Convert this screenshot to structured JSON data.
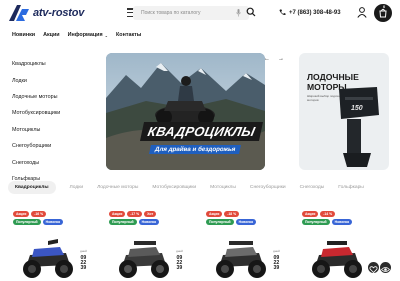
{
  "header": {
    "logo_text": "atv-rostov",
    "search_placeholder": "Поиск товара по каталогу",
    "phone": "+7 (863) 308-48-93",
    "cart_count": "0"
  },
  "nav": {
    "items": [
      "Новинки",
      "Акции",
      "Информация",
      "Контакты"
    ]
  },
  "sidebar": {
    "items": [
      "Квадроциклы",
      "Лодки",
      "Лодочные моторы",
      "Мотобуксировщики",
      "Мотоциклы",
      "Снегоуборщики",
      "Снегоходы",
      "Гольфкары"
    ]
  },
  "banner": {
    "title": "КВАДРОЦИКЛЫ",
    "subtitle": "Для драйва и бездорожья",
    "prev": "←",
    "next": "→"
  },
  "side_banner": {
    "title_line1": "ЛОДОЧНЫЕ",
    "title_line2": "МОТОРЫ",
    "subtitle": "Широкий выбор лодочных моторов",
    "engine_mark": "150"
  },
  "tabs": [
    "Квадроциклы",
    "Лодки",
    "Лодочные моторы",
    "Мотобуксировщики",
    "Мотоциклы",
    "Снегоуборщики",
    "Снегоходы",
    "Гольфкары"
  ],
  "products": [
    {
      "badges": [
        "Акция",
        "-16 %",
        "Популярный",
        "Новинка"
      ],
      "timer_label": "дней",
      "timer": [
        "09",
        "22",
        "39"
      ]
    },
    {
      "badges": [
        "Акция",
        "-17 %",
        "Хит",
        "Популярный",
        "Новинка"
      ],
      "timer_label": "дней",
      "timer": [
        "09",
        "22",
        "39"
      ]
    },
    {
      "badges": [
        "Акция",
        "-18 %",
        "Популярный",
        "Новинка"
      ],
      "timer_label": "дней",
      "timer": [
        "09",
        "22",
        "39"
      ]
    },
    {
      "badges": [
        "Акция",
        "-14 %",
        "Популярный",
        "Новинка"
      ],
      "timer_label": "",
      "timer": []
    }
  ],
  "colors": {
    "accent_dark": "#1a1a1a",
    "badge_red": "#e14a3b",
    "badge_green": "#2e9b52",
    "badge_blue": "#3865d6",
    "banner_blue": "#1f5fbf"
  }
}
